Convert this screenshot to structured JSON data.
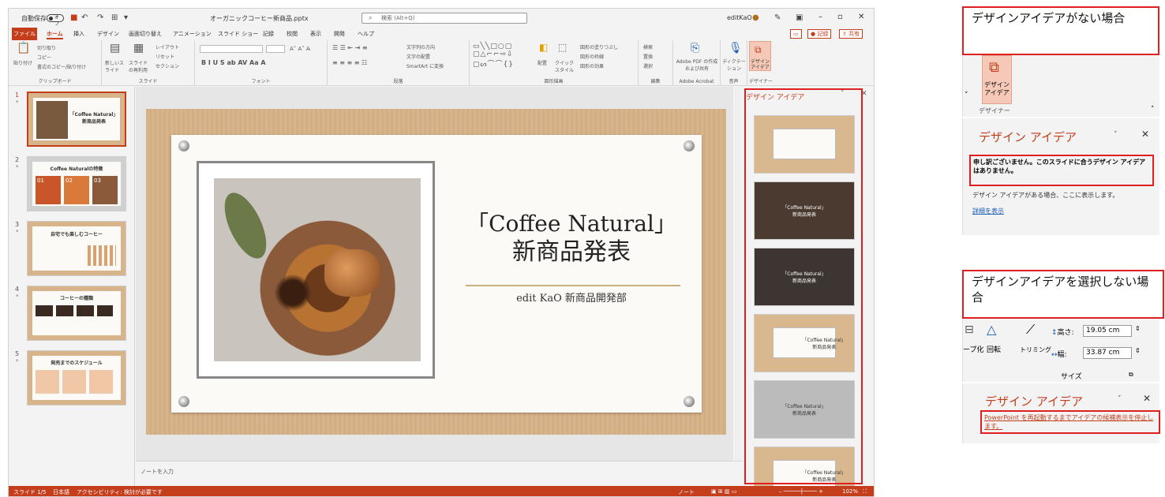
{
  "titlebar": {
    "autosave": "自動保存",
    "toggle": "オフ",
    "filename": "オーガニックコーヒー新商品.pptx",
    "search": "検索 (Alt+Q)",
    "user": "editKaO"
  },
  "tabs": [
    "ファイル",
    "ホーム",
    "挿入",
    "デザイン",
    "画面切り替え",
    "アニメーション",
    "スライド ショー",
    "記録",
    "校閲",
    "表示",
    "開発",
    "ヘルプ"
  ],
  "tab_buttons": {
    "record": "記録",
    "share": "共有"
  },
  "ribbon": {
    "groups": [
      "クリップボード",
      "スライド",
      "フォント",
      "段落",
      "図形描画",
      "編集",
      "Adobe Acrobat",
      "音声",
      "デザイナー"
    ],
    "paste": "貼り付け",
    "cut": "切り取り",
    "copy": "コピー",
    "format_painter": "書式のコピー/貼り付け",
    "new_slide": "新しいスライド",
    "reuse_slide": "スライドの再利用",
    "layout": "レイアウト",
    "reset": "リセット",
    "section": "セクション",
    "text_direction": "文字列の方向",
    "align_text": "文字の配置",
    "smartart": "SmartArt に変換",
    "arrange": "配置",
    "quick_style": "クイックスタイル",
    "fill": "図形の塗りつぶし",
    "outline": "図形の枠線",
    "effect": "図形の効果",
    "find": "検索",
    "replace": "置換",
    "select": "選択",
    "adobe": "Adobe PDF の作成および共有",
    "dictate": "ディクテーション",
    "designer_btn": "デザインアイデア"
  },
  "slides": [
    {
      "num": "1",
      "title": "「Coffee Natural」新商品発表"
    },
    {
      "num": "2",
      "title": "Coffee Naturalの特徴"
    },
    {
      "num": "3",
      "title": "自宅でも楽しむコーヒー"
    },
    {
      "num": "4",
      "title": "コーヒーの種類"
    },
    {
      "num": "5",
      "title": "発売までのスケジュール"
    }
  ],
  "slide2": {
    "n1": "01",
    "n2": "02",
    "n3": "03"
  },
  "main_slide": {
    "title_line1": "「Coffee Natural」",
    "title_line2": "新商品発表",
    "subtitle": "edit KaO 新商品開発部"
  },
  "notes_placeholder": "ノートを入力",
  "design_pane": {
    "title": "デザイン アイデア",
    "ideas": [
      {
        "line1": "",
        "line2": ""
      },
      {
        "line1": "「Coffee Natural」",
        "line2": "新商品発表"
      },
      {
        "line1": "「Coffee Natural」",
        "line2": "新商品発表"
      },
      {
        "line1": "「Coffee Natural」",
        "line2": "新商品発表"
      },
      {
        "line1": "「Coffee Natural」",
        "line2": "新商品発表"
      },
      {
        "line1": "「Coffee Natural」",
        "line2": "新商品発表"
      }
    ]
  },
  "statusbar": {
    "slide": "スライド 1/5",
    "lang": "日本語",
    "accessibility": "アクセシビリティ: 検討が必要です",
    "notes": "ノート",
    "zoom": "102%"
  },
  "annotations": {
    "no_idea_label": "デザインアイデアがない場合",
    "designer_short": "デザイン アイデア",
    "designer_group": "デザイナー",
    "panel_title": "デザイン アイデア",
    "no_idea_msg": "申し訳ございません。このスライドに合うデザイン アイデアはありません。",
    "no_idea_hint": "デザイン アイデアがある場合、ここに表示します。",
    "details_link": "詳細を表示",
    "not_selected_label": "デザインアイデアを選択しない場合",
    "height_label": "高さ:",
    "height_val": "19.05 cm",
    "width_label": "幅:",
    "width_val": "33.87 cm",
    "rotate": "回転",
    "trim": "トリミング",
    "size": "サイズ",
    "group_frag": "ープ化",
    "restart_msg": "PowerPoint を再起動するまでアイデアの候補表示を停止します。"
  }
}
